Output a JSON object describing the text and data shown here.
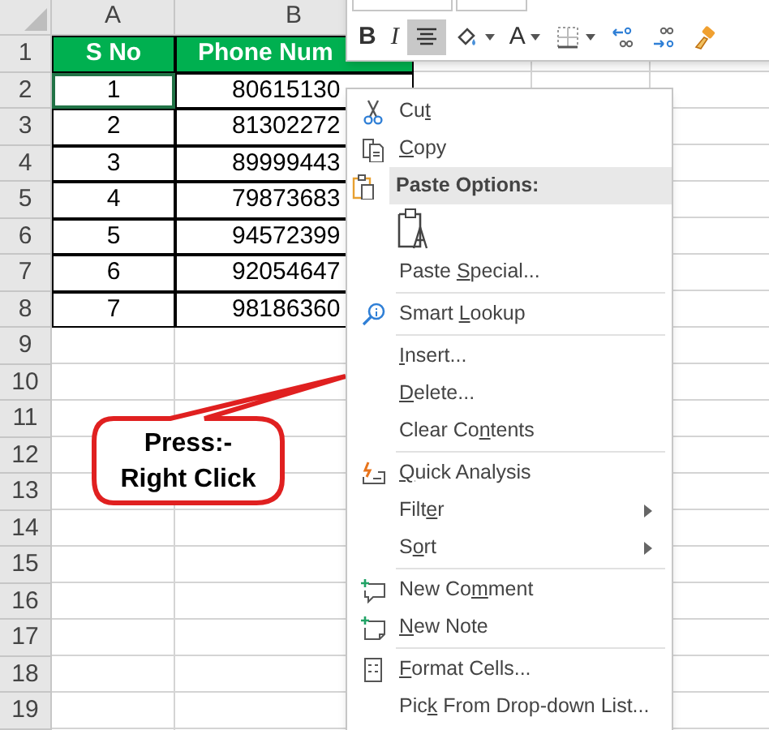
{
  "column_headers": [
    "A",
    "B"
  ],
  "row_numbers": [
    "1",
    "2",
    "3",
    "4",
    "5",
    "6",
    "7",
    "8",
    "9",
    "10",
    "11",
    "12",
    "13",
    "14",
    "15",
    "16",
    "17",
    "18",
    "19"
  ],
  "table": {
    "header": [
      "S No",
      "Phone Num"
    ],
    "rows": [
      {
        "cells": [
          "1",
          "80615130"
        ],
        "active": true
      },
      {
        "cells": [
          "2",
          "81302272"
        ],
        "active": false
      },
      {
        "cells": [
          "3",
          "89999443"
        ],
        "active": false
      },
      {
        "cells": [
          "4",
          "79873683"
        ],
        "active": false
      },
      {
        "cells": [
          "5",
          "94572399"
        ],
        "active": false
      },
      {
        "cells": [
          "6",
          "92054647"
        ],
        "active": false
      },
      {
        "cells": [
          "7",
          "98186360"
        ],
        "active": false
      }
    ]
  },
  "mini_toolbar": {
    "buttons": [
      {
        "kind": "bold",
        "text": "B",
        "selected": false,
        "dropdown": false
      },
      {
        "kind": "italic",
        "text": "I",
        "selected": false,
        "dropdown": false
      },
      {
        "kind": "align_center",
        "selected": true,
        "dropdown": false
      },
      {
        "kind": "fill_color",
        "selected": false,
        "dropdown": true
      },
      {
        "kind": "font_color",
        "text": "A",
        "selected": false,
        "dropdown": true
      },
      {
        "kind": "borders",
        "selected": false,
        "dropdown": true
      },
      {
        "kind": "increase_decimal",
        "selected": false,
        "dropdown": false
      },
      {
        "kind": "decrease_decimal",
        "selected": false,
        "dropdown": false
      },
      {
        "kind": "format_painter",
        "selected": false,
        "dropdown": false
      }
    ]
  },
  "context_menu": {
    "items": [
      {
        "kind": "item",
        "label": "Cut",
        "submenu": false
      },
      {
        "kind": "item",
        "label": "Copy",
        "submenu": false
      },
      {
        "kind": "heading",
        "label": "Paste Options:"
      },
      {
        "kind": "paste_icon"
      },
      {
        "kind": "item",
        "label": "Paste Special...",
        "submenu": false
      },
      {
        "kind": "separator"
      },
      {
        "kind": "item",
        "label": "Smart Lookup",
        "submenu": false
      },
      {
        "kind": "separator"
      },
      {
        "kind": "item",
        "label": "Insert...",
        "submenu": false
      },
      {
        "kind": "item",
        "label": "Delete...",
        "submenu": false
      },
      {
        "kind": "item",
        "label": "Clear Contents",
        "submenu": false
      },
      {
        "kind": "separator"
      },
      {
        "kind": "item",
        "label": "Quick Analysis",
        "submenu": false
      },
      {
        "kind": "item",
        "label": "Filter",
        "submenu": true
      },
      {
        "kind": "item",
        "label": "Sort",
        "submenu": true
      },
      {
        "kind": "separator"
      },
      {
        "kind": "item",
        "label": "New Comment",
        "submenu": false
      },
      {
        "kind": "item",
        "label": "New Note",
        "submenu": false
      },
      {
        "kind": "separator"
      },
      {
        "kind": "item",
        "label": "Format Cells...",
        "submenu": false
      },
      {
        "kind": "item",
        "label": "Pick From Drop-down List...",
        "submenu": false
      }
    ]
  },
  "callout": {
    "lines": [
      "Press:-",
      "Right Click"
    ]
  }
}
